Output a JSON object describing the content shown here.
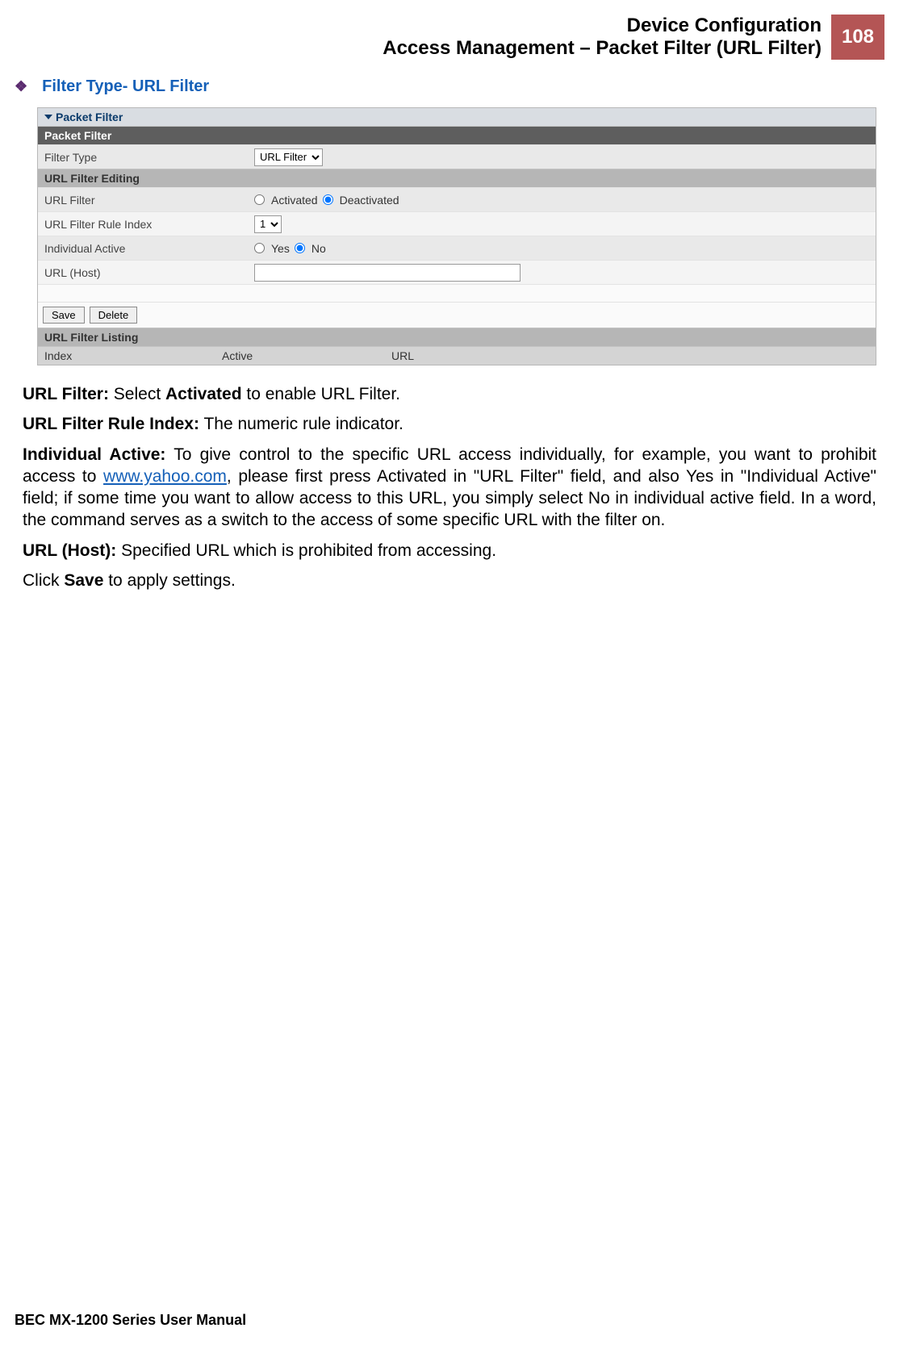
{
  "header": {
    "line1": "Device Configuration",
    "line2": "Access Management – Packet Filter (URL Filter)",
    "page_number": "108"
  },
  "section": {
    "bullet": "❖",
    "title": "Filter Type- URL Filter"
  },
  "shot": {
    "panel_title": "Packet Filter",
    "sub_packet_filter": "Packet Filter",
    "filter_type_label": "Filter Type",
    "filter_type_value": "URL Filter",
    "sub_url_filter_editing": "URL Filter Editing",
    "url_filter_label": "URL Filter",
    "activated_label": "Activated",
    "deactivated_label": "Deactivated",
    "url_filter_rule_index_label": "URL Filter Rule Index",
    "url_filter_rule_index_value": "1",
    "individual_active_label": "Individual Active",
    "yes_label": "Yes",
    "no_label": "No",
    "url_host_label": "URL (Host)",
    "url_host_value": "",
    "save_label": "Save",
    "delete_label": "Delete",
    "sub_url_filter_listing": "URL Filter Listing",
    "listing_col_index": "Index",
    "listing_col_active": "Active",
    "listing_col_url": "URL"
  },
  "body": {
    "p1_bold": "URL Filter:",
    "p1_rest_a": " Select ",
    "p1_bold2": "Activated",
    "p1_rest_b": " to enable URL Filter.",
    "p2_bold": "URL Filter Rule Index:",
    "p2_rest": " The numeric rule indicator.",
    "p3_bold": "Individual Active:",
    "p3_rest_a": " To give control to the specific URL access individually, for example, you want to prohibit access to ",
    "p3_link": "www.yahoo.com",
    "p3_rest_b": ", please first press Activated in \"URL Filter\" field, and also Yes in \"Individual Active\" field; if some time you want to allow access to this URL, you simply select No in individual active field. In a word, the command serves as a switch to the access of some specific URL with the filter on.",
    "p4_bold": "URL (Host):",
    "p4_rest": " Specified URL which is prohibited from accessing.",
    "p5_a": "Click ",
    "p5_bold": "Save",
    "p5_b": " to apply settings."
  },
  "footer": {
    "text": "BEC MX-1200 Series User Manual"
  }
}
